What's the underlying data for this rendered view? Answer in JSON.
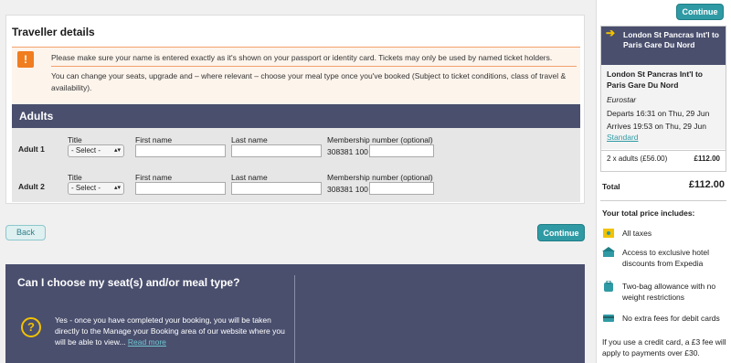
{
  "traveller": {
    "title": "Traveller details",
    "notice_line1": "Please make sure your name is entered exactly as it's shown on your passport or identity card. Tickets may only be used by named ticket holders.",
    "notice_line2": "You can change your seats, upgrade and – where relevant – choose your meal type once you've booked (Subject to ticket conditions, class of travel & availability).",
    "notice_icon": "!"
  },
  "adults": {
    "header": "Adults",
    "rows": [
      {
        "label": "Adult 1",
        "title_label": "Title",
        "title_value": "- Select -",
        "first_label": "First name",
        "last_label": "Last name",
        "membership_label": "Membership number (optional)",
        "membership_code": "308381 100"
      },
      {
        "label": "Adult 2",
        "title_label": "Title",
        "title_value": "- Select -",
        "first_label": "First name",
        "last_label": "Last name",
        "membership_label": "Membership number (optional)",
        "membership_code": "308381 100"
      }
    ]
  },
  "actions": {
    "back": "Back",
    "continue": "Continue"
  },
  "faq": {
    "title": "Can I choose my seat(s) and/or meal type?",
    "icon": "?",
    "text": "Yes - once you have completed your booking, you will be taken directly to the Manage your Booking area of our website where you will be able to view...",
    "link": "Read more"
  },
  "sidebar": {
    "continue": "Continue",
    "route_head": "London St Pancras Int'l to Paris Gare Du Nord",
    "route_title": "London St Pancras Int'l to Paris Gare Du Nord",
    "operator": "Eurostar",
    "departs": "Departs 16:31 on Thu, 29 Jun",
    "arrives": "Arrives 19:53 on Thu, 29 Jun",
    "class": "Standard",
    "price_line": "2 x adults (£56.00)",
    "price_value": "£112.00",
    "total_label": "Total",
    "total_value": "£112.00",
    "includes_title": "Your total price includes:",
    "includes": [
      "All taxes",
      "Access to exclusive hotel discounts from Expedia",
      "Two-bag allowance with no weight restrictions",
      "No extra fees for debit cards"
    ],
    "credit_note": "If you use a credit card, a £3 fee will apply to payments over £30."
  }
}
